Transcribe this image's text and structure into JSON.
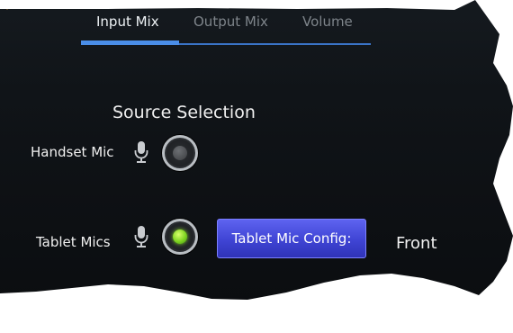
{
  "tabs": [
    {
      "label": "Input Mix",
      "active": true
    },
    {
      "label": "Output Mix",
      "active": false
    },
    {
      "label": "Volume",
      "active": false
    }
  ],
  "section_title": "Source Selection",
  "sources": [
    {
      "label": "Handset Mic",
      "icon": "microphone-icon",
      "selected": false
    },
    {
      "label": "Tablet Mics",
      "icon": "microphone-icon",
      "selected": true
    }
  ],
  "config_button_label": "Tablet Mic Config:",
  "config_value": "Front",
  "colors": {
    "accent_blue": "#4a8ee8",
    "button_purple": "#4a4fe0",
    "selected_green": "#7ed321",
    "background": "#0f1216"
  }
}
